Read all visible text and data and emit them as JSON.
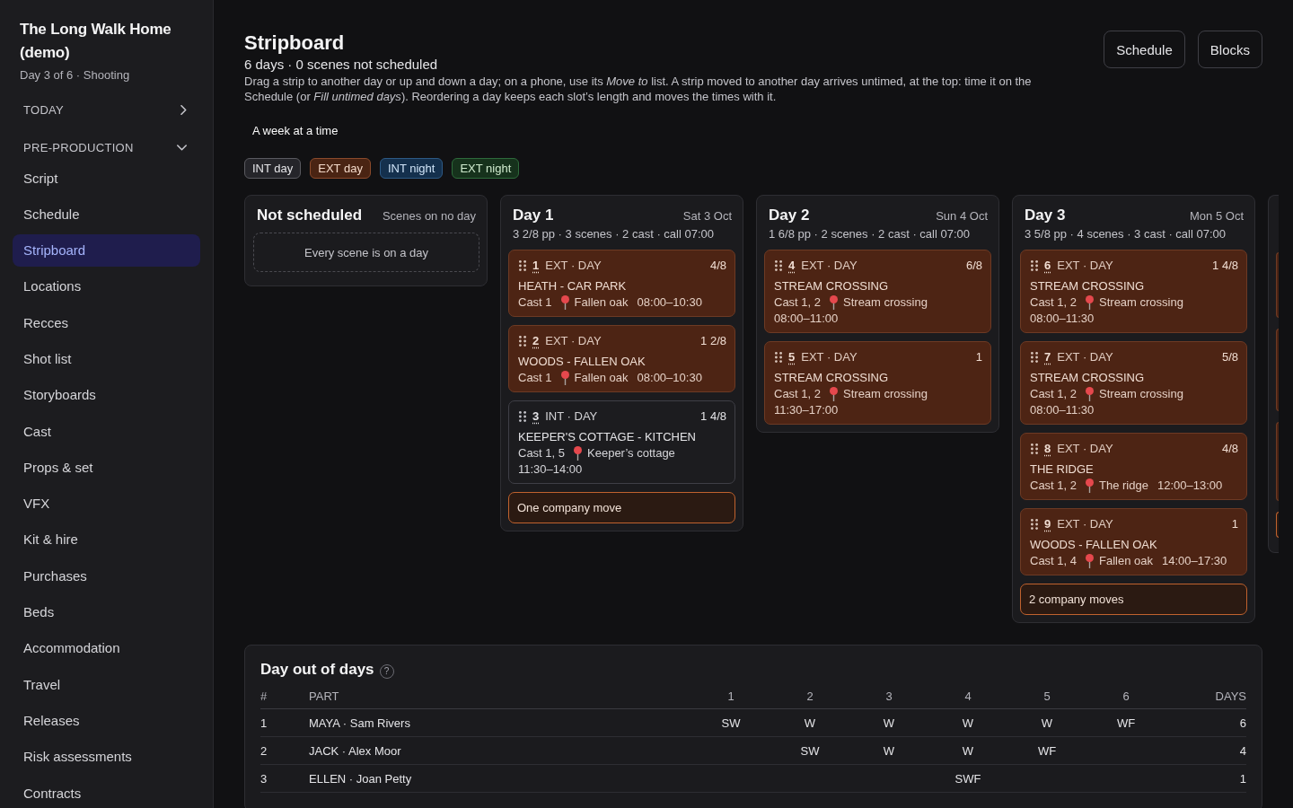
{
  "sidebar": {
    "project_title": "The Long Walk Home (demo)",
    "project_status": "Day 3 of 6 · Shooting",
    "sections": [
      {
        "label": "TODAY",
        "expanded": false
      },
      {
        "label": "PRE-PRODUCTION",
        "expanded": true,
        "items": [
          {
            "label": "Script",
            "selected": false
          },
          {
            "label": "Schedule",
            "selected": false
          },
          {
            "label": "Stripboard",
            "selected": true
          },
          {
            "label": "Locations",
            "selected": false
          },
          {
            "label": "Recces",
            "selected": false
          },
          {
            "label": "Shot list",
            "selected": false
          },
          {
            "label": "Storyboards",
            "selected": false
          },
          {
            "label": "Cast",
            "selected": false
          },
          {
            "label": "Props & set",
            "selected": false
          },
          {
            "label": "VFX",
            "selected": false
          },
          {
            "label": "Kit & hire",
            "selected": false
          },
          {
            "label": "Purchases",
            "selected": false
          },
          {
            "label": "Beds",
            "selected": false
          },
          {
            "label": "Accommodation",
            "selected": false
          },
          {
            "label": "Travel",
            "selected": false
          },
          {
            "label": "Releases",
            "selected": false
          },
          {
            "label": "Risk assessments",
            "selected": false
          },
          {
            "label": "Contracts",
            "selected": false
          }
        ]
      }
    ]
  },
  "header": {
    "title": "Stripboard",
    "summary": "6 days · 0 scenes not scheduled",
    "description": "Drag a strip to another day or up and down a day; on a phone, use its *Move to* list. A strip moved to another day arrives untimed, at the top: time it on the Schedule (or *Fill untimed days*). Reordering a day keeps each slot’s length and moves the times with it.",
    "buttons": [
      "Schedule",
      "Blocks"
    ]
  },
  "view_toggle": "A week at a time",
  "legend": [
    {
      "label": "INT day",
      "kind": "int_day"
    },
    {
      "label": "EXT day",
      "kind": "ext_day"
    },
    {
      "label": "INT night",
      "kind": "int_night"
    },
    {
      "label": "EXT night",
      "kind": "ext_night"
    }
  ],
  "not_scheduled": {
    "title": "Not scheduled",
    "subtitle": "Scenes on no day",
    "empty_message": "Every scene is on a day"
  },
  "days": [
    {
      "title": "Day 1",
      "date": "Sat 3 Oct",
      "summary": "3 2/8 pp · 3 scenes · 2 cast · call 07:00",
      "strips": [
        {
          "kind": "ext_day",
          "number": "1",
          "setting": "EXT · DAY",
          "length": "4/8",
          "title": "HEATH - CAR PARK",
          "cast": "Cast 1",
          "location": "Fallen oak",
          "time": "08:00–10:30"
        },
        {
          "kind": "ext_day",
          "number": "2",
          "setting": "EXT · DAY",
          "length": "1 2/8",
          "title": "WOODS - FALLEN OAK",
          "cast": "Cast 1",
          "location": "Fallen oak",
          "time": "08:00–10:30"
        },
        {
          "kind": "int_day",
          "number": "3",
          "setting": "INT · DAY",
          "length": "1 4/8",
          "title": "KEEPER'S COTTAGE - KITCHEN",
          "cast": "Cast 1, 5",
          "location": "Keeper’s cottage",
          "time": "11:30–14:00"
        }
      ],
      "moves": "One company move"
    },
    {
      "title": "Day 2",
      "date": "Sun 4 Oct",
      "summary": "1 6/8 pp · 2 scenes · 2 cast · call 07:00",
      "strips": [
        {
          "kind": "ext_day",
          "number": "4",
          "setting": "EXT · DAY",
          "length": "6/8",
          "title": "STREAM CROSSING",
          "cast": "Cast 1, 2",
          "location": "Stream crossing",
          "time": "08:00–11:00"
        },
        {
          "kind": "ext_day",
          "number": "5",
          "setting": "EXT · DAY",
          "length": "1",
          "title": "STREAM CROSSING",
          "cast": "Cast 1, 2",
          "location": "Stream crossing",
          "time": "11:30–17:00"
        }
      ]
    },
    {
      "title": "Day 3",
      "date": "Mon 5 Oct",
      "summary": "3 5/8 pp · 4 scenes · 3 cast · call 07:00",
      "strips": [
        {
          "kind": "ext_day",
          "number": "6",
          "setting": "EXT · DAY",
          "length": "1 4/8",
          "title": "STREAM CROSSING",
          "cast": "Cast 1, 2",
          "location": "Stream crossing",
          "time": "08:00–11:30"
        },
        {
          "kind": "ext_day",
          "number": "7",
          "setting": "EXT · DAY",
          "length": "5/8",
          "title": "STREAM CROSSING",
          "cast": "Cast 1, 2",
          "location": "Stream crossing",
          "time": "08:00–11:30"
        },
        {
          "kind": "ext_day",
          "number": "8",
          "setting": "EXT · DAY",
          "length": "4/8",
          "title": "THE RIDGE",
          "cast": "Cast 1, 2",
          "location": "The ridge",
          "time": "12:00–13:00"
        },
        {
          "kind": "ext_day",
          "number": "9",
          "setting": "EXT · DAY",
          "length": "1",
          "title": "WOODS - FALLEN OAK",
          "cast": "Cast 1, 4",
          "location": "Fallen oak",
          "time": "14:00–17:30"
        }
      ],
      "moves": "2 company moves"
    },
    {
      "cut_off": true,
      "strips": [
        {
          "kind": "ext_day"
        },
        {
          "kind": "ext_day"
        },
        {
          "kind": "ext_day"
        }
      ],
      "move_bar": true
    }
  ],
  "day_out_of_days": {
    "title": "Day out of days",
    "help": "?",
    "columns": [
      "#",
      "PART",
      "1",
      "2",
      "3",
      "4",
      "5",
      "6",
      "DAYS"
    ],
    "rows": [
      {
        "number": "1",
        "part": "MAYA · Sam Rivers",
        "marks": {
          "day_1": "SW",
          "day_2": "W",
          "day_3": "W",
          "day_4": "W",
          "day_5": "W",
          "day_6": "WF"
        },
        "total": "6"
      },
      {
        "number": "2",
        "part": "JACK · Alex Moor",
        "marks": {
          "day_2": "SW",
          "day_3": "W",
          "day_4": "W",
          "day_5": "WF"
        },
        "total": "4"
      },
      {
        "number": "3",
        "part": "ELLEN · Joan Petty",
        "marks": {
          "day_4": "SWF"
        },
        "total": "1"
      }
    ]
  }
}
